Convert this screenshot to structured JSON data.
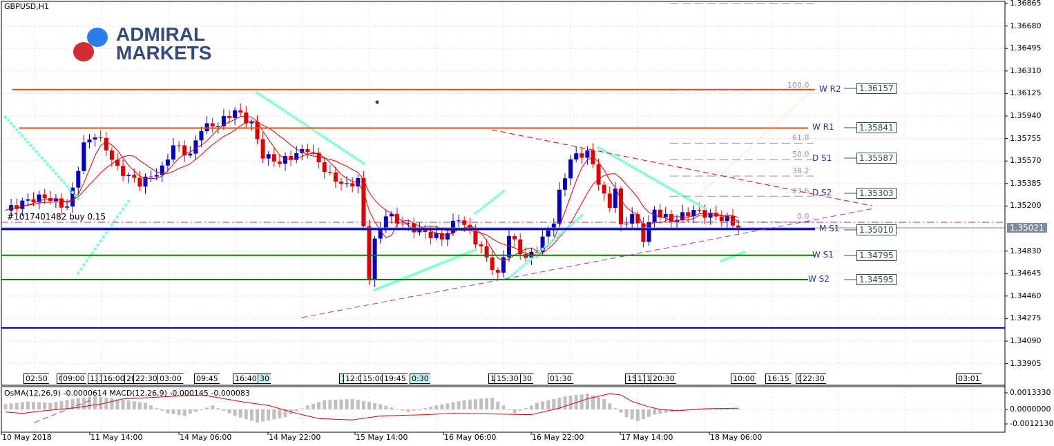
{
  "header": {
    "symbol": "GBPUSD,H1",
    "logo_text": [
      "ADMIRAL",
      "MARKETS"
    ],
    "order_label": "#1017401482 buy 0.15"
  },
  "colors": {
    "bull": "#0000c8",
    "bear": "#e00000",
    "resistance": "#ff4500",
    "support": "#008000",
    "pivot": "#0000c8",
    "sar": "#7fffd4",
    "ma": "#e00000",
    "current": "#7f8c9c"
  },
  "levels": [
    {
      "name": "W R2",
      "value": "1.36157",
      "price": 1.36157,
      "color": "#ff4500"
    },
    {
      "name": "W R1",
      "value": "1.35841",
      "price": 1.35841,
      "color": "#ff4500"
    },
    {
      "name": "D S1",
      "value": "1.35587",
      "price": 1.35587,
      "color": "none"
    },
    {
      "name": "D S2",
      "value": "1.35303",
      "price": 1.35303,
      "color": "none"
    },
    {
      "name": "M S1",
      "value": "1.35010",
      "price": 1.3501,
      "color": "#0000c8"
    },
    {
      "name": "W S1",
      "value": "1.34795",
      "price": 1.34795,
      "color": "#008000"
    },
    {
      "name": "W S2",
      "value": "1.34595",
      "price": 1.34595,
      "color": "#008000"
    }
  ],
  "fib_labels": [
    {
      "label": "100.0",
      "price": 1.36157
    },
    {
      "label": "61.8",
      "price": 1.35722
    },
    {
      "label": "50.0",
      "price": 1.35587
    },
    {
      "label": "38.2",
      "price": 1.35452
    },
    {
      "label": "23.6",
      "price": 1.35286
    },
    {
      "label": "0.0",
      "price": 1.35075
    }
  ],
  "current_price": "1.35021",
  "price_axis": [
    "1.36865",
    "1.36680",
    "1.36495",
    "1.36310",
    "1.36125",
    "1.35940",
    "1.35755",
    "1.35570",
    "1.35385",
    "1.35200",
    "1.35021",
    "1.34830",
    "1.34645",
    "1.34460",
    "1.34275",
    "1.34090",
    "1.33905"
  ],
  "time_labels": [
    {
      "t": "02:50"
    },
    {
      "t": "C"
    },
    {
      "t": "09:00"
    },
    {
      "t": "13"
    },
    {
      "t": "1"
    },
    {
      "t": "16:00"
    },
    {
      "t": "20"
    },
    {
      "t": "22:30"
    },
    {
      "t": "03:00"
    },
    {
      "t": "09:45"
    },
    {
      "t": "16:40"
    },
    {
      "t": "30",
      "h": true
    },
    {
      "t": "1",
      "h": true
    },
    {
      "t": "12:0"
    },
    {
      "t": "15:00"
    },
    {
      "t": "19:45"
    },
    {
      "t": "0:30",
      "h": true
    },
    {
      "t": "1"
    },
    {
      "t": "15:30"
    },
    {
      "t": "30"
    },
    {
      "t": "01:30"
    },
    {
      "t": "15"
    },
    {
      "t": "17"
    },
    {
      "t": "1"
    },
    {
      "t": "20:30"
    },
    {
      "t": "10:00"
    },
    {
      "t": "16:15"
    },
    {
      "t": "0:"
    },
    {
      "t": "22:30"
    },
    {
      "t": "03:01"
    }
  ],
  "indicator": {
    "title": "OsMA(12,26,9) -0.0000614 MACD(12,26,9) -0.000145 -0.000083",
    "axis": [
      "0.0013330",
      "0.0000000",
      "-0.0012130"
    ]
  },
  "date_axis": [
    "10 May 2018",
    "11 May 14:00",
    "14 May 06:00",
    "14 May 22:00",
    "15 May 14:00",
    "16 May 06:00",
    "16 May 22:00",
    "17 May 14:00",
    "18 May 06:00"
  ],
  "chart_data": {
    "type": "candlestick",
    "title": "GBPUSD,H1",
    "ylim": [
      1.33905,
      1.36865
    ],
    "price_path": [
      [
        0,
        1.35163
      ],
      [
        4,
        1.35248
      ],
      [
        7,
        1.35276
      ],
      [
        11,
        1.35191
      ],
      [
        12,
        1.35333
      ],
      [
        14,
        1.35702
      ],
      [
        16,
        1.35787
      ],
      [
        18,
        1.35673
      ],
      [
        20,
        1.35503
      ],
      [
        24,
        1.35389
      ],
      [
        28,
        1.35503
      ],
      [
        30,
        1.35702
      ],
      [
        33,
        1.35616
      ],
      [
        35,
        1.35843
      ],
      [
        38,
        1.35872
      ],
      [
        41,
        1.35985
      ],
      [
        44,
        1.35872
      ],
      [
        46,
        1.35616
      ],
      [
        49,
        1.3556
      ],
      [
        54,
        1.35673
      ],
      [
        58,
        1.35446
      ],
      [
        61,
        1.35361
      ],
      [
        63,
        1.35418
      ],
      [
        64,
        1.35021
      ],
      [
        65,
        1.34623
      ],
      [
        66,
        1.34907
      ],
      [
        68,
        1.35134
      ],
      [
        70,
        1.35077
      ],
      [
        74,
        1.34992
      ],
      [
        78,
        1.34935
      ],
      [
        81,
        1.35106
      ],
      [
        85,
        1.3485
      ],
      [
        88,
        1.34623
      ],
      [
        90,
        1.34964
      ],
      [
        93,
        1.34765
      ],
      [
        95,
        1.3485
      ],
      [
        98,
        1.35077
      ],
      [
        99,
        1.35304
      ],
      [
        101,
        1.35588
      ],
      [
        104,
        1.35645
      ],
      [
        105,
        1.35531
      ],
      [
        107,
        1.35276
      ],
      [
        108,
        1.35191
      ],
      [
        109,
        1.35361
      ],
      [
        110,
        1.35021
      ],
      [
        112,
        1.35134
      ],
      [
        114,
        1.34935
      ],
      [
        116,
        1.35163
      ],
      [
        119,
        1.35077
      ],
      [
        123,
        1.35163
      ],
      [
        125,
        1.35134
      ],
      [
        129,
        1.35089
      ],
      [
        131,
        1.35021
      ]
    ],
    "sar": [
      [
        [
          0,
          1.3593
        ],
        [
          13,
          1.3526
        ]
      ],
      [
        [
          13,
          1.3465
        ],
        [
          22,
          1.3524
        ]
      ],
      [
        [
          45,
          1.3613
        ],
        [
          64,
          1.3555
        ]
      ],
      [
        [
          66,
          1.3451
        ],
        [
          84,
          1.3484
        ]
      ],
      [
        [
          84,
          1.3514
        ],
        [
          89,
          1.3532
        ]
      ],
      [
        [
          90,
          1.3461
        ],
        [
          103,
          1.3512
        ]
      ],
      [
        [
          106,
          1.3568
        ],
        [
          125,
          1.3518
        ]
      ],
      [
        [
          128,
          1.3475
        ],
        [
          132,
          1.3482
        ]
      ]
    ],
    "histogram_x1e4": [
      [
        0,
        4
      ],
      [
        4,
        6
      ],
      [
        8,
        5
      ],
      [
        12,
        8
      ],
      [
        16,
        10
      ],
      [
        20,
        8
      ],
      [
        25,
        5
      ],
      [
        29,
        -3
      ],
      [
        32,
        -5
      ],
      [
        37,
        3
      ],
      [
        41,
        -5
      ],
      [
        45,
        -10
      ],
      [
        50,
        -6
      ],
      [
        54,
        3
      ],
      [
        57,
        7
      ],
      [
        62,
        8
      ],
      [
        67,
        4
      ],
      [
        72,
        -2
      ],
      [
        77,
        3
      ],
      [
        82,
        7
      ],
      [
        87,
        9
      ],
      [
        91,
        -3
      ],
      [
        95,
        5
      ],
      [
        100,
        10
      ],
      [
        104,
        12
      ],
      [
        107,
        8
      ],
      [
        111,
        -6
      ],
      [
        113,
        -9
      ],
      [
        116,
        -4
      ],
      [
        120,
        -1
      ],
      [
        125,
        0
      ],
      [
        132,
        0
      ]
    ],
    "macd_x1e4": [
      [
        0,
        -2
      ],
      [
        3,
        -3
      ],
      [
        7,
        -1
      ],
      [
        12,
        1
      ],
      [
        17,
        4
      ],
      [
        21,
        8
      ],
      [
        30,
        10
      ],
      [
        35,
        11
      ],
      [
        38,
        9
      ],
      [
        42,
        6
      ],
      [
        47,
        3
      ],
      [
        52,
        -3
      ],
      [
        56,
        -7
      ],
      [
        62,
        -8
      ],
      [
        67,
        -5
      ],
      [
        75,
        -4
      ],
      [
        80,
        -3
      ],
      [
        94,
        -4
      ],
      [
        99,
        1
      ],
      [
        104,
        8
      ],
      [
        108,
        12
      ],
      [
        110,
        11
      ],
      [
        112,
        6
      ],
      [
        115,
        2
      ],
      [
        117,
        0
      ],
      [
        120,
        -1
      ],
      [
        125,
        0.5
      ],
      [
        132,
        1
      ]
    ]
  }
}
